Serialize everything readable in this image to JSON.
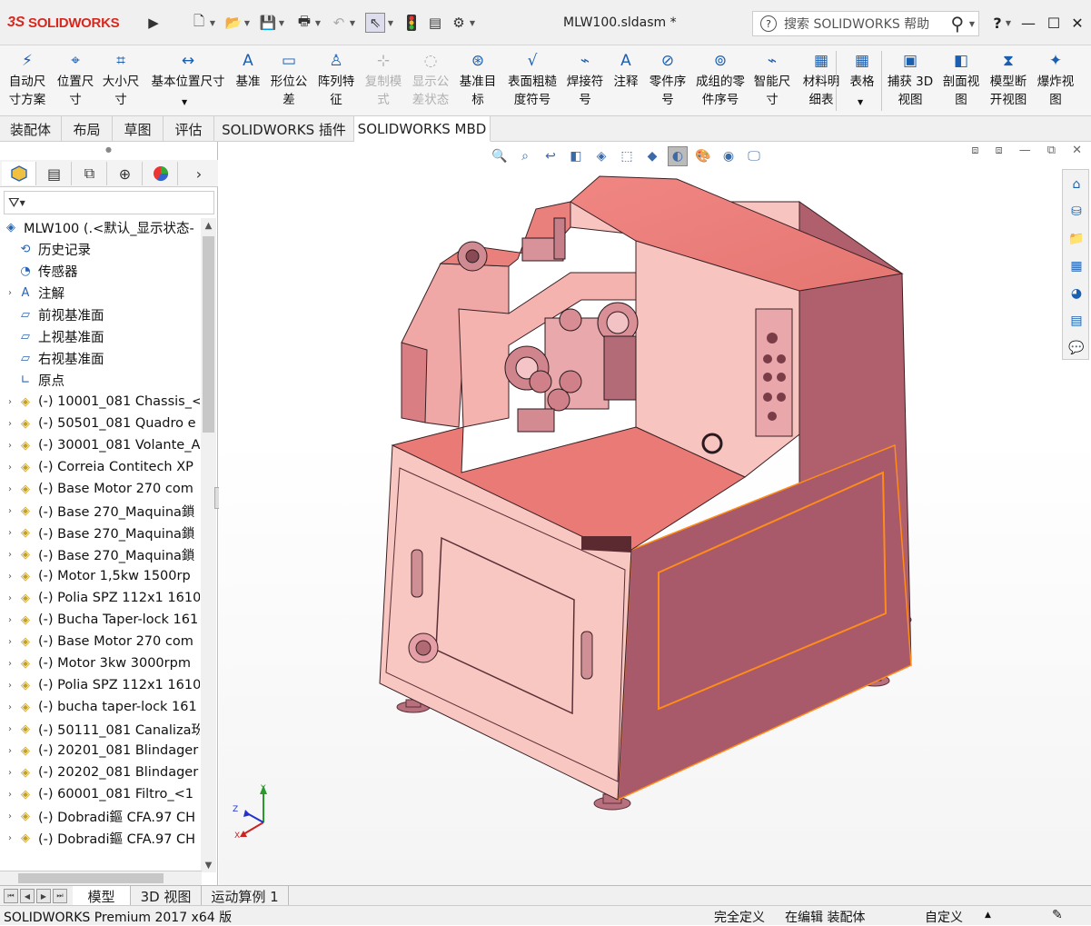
{
  "app": {
    "logo_ds": "3S",
    "logo_text": "SOLIDWORKS",
    "doc_title": "MLW100.sldasm *"
  },
  "search": {
    "placeholder": "搜索 SOLIDWORKS 帮助"
  },
  "quick_icons": [
    "new-icon",
    "open-icon",
    "save-icon",
    "print-icon",
    "undo-icon",
    "select-icon",
    "traffic-light-icon",
    "file-props-icon",
    "options-icon"
  ],
  "window": {
    "help": "?",
    "minimize": "—",
    "maximize": "☐",
    "close": "✕"
  },
  "ribbon": [
    {
      "id": "auto-dim",
      "lines": [
        "自动尺",
        "寸方案"
      ],
      "icon": "auto-dimension-icon",
      "enabled": true
    },
    {
      "id": "location-dim",
      "lines": [
        "位置尺",
        "寸"
      ],
      "icon": "location-dimension-icon",
      "enabled": true
    },
    {
      "id": "size-dim",
      "lines": [
        "大小尺",
        "寸"
      ],
      "icon": "size-dimension-icon",
      "enabled": true
    },
    {
      "id": "basic-location-dim",
      "lines": [
        "基本位置尺寸",
        ""
      ],
      "icon": "basic-location-icon",
      "enabled": true
    },
    {
      "id": "datum",
      "lines": [
        "基准",
        ""
      ],
      "icon": "datum-icon",
      "enabled": true
    },
    {
      "id": "geo-tol",
      "lines": [
        "形位公",
        "差"
      ],
      "icon": "geometric-tolerance-icon",
      "enabled": true
    },
    {
      "id": "pattern-feature",
      "lines": [
        "阵列特",
        "征"
      ],
      "icon": "pattern-feature-icon",
      "enabled": true
    },
    {
      "id": "copy-scheme",
      "lines": [
        "复制模",
        "式"
      ],
      "icon": "copy-scheme-icon",
      "enabled": false
    },
    {
      "id": "show-tol-status",
      "lines": [
        "显示公",
        "差状态"
      ],
      "icon": "tolerance-status-icon",
      "enabled": false
    },
    {
      "id": "datum-target",
      "lines": [
        "基准目",
        "标"
      ],
      "icon": "datum-target-icon",
      "enabled": true
    },
    {
      "id": "surface-finish",
      "lines": [
        "表面粗糙",
        "度符号"
      ],
      "icon": "surface-finish-icon",
      "enabled": true
    },
    {
      "id": "weld-symbol",
      "lines": [
        "焊接符",
        "号"
      ],
      "icon": "weld-symbol-icon",
      "enabled": true
    },
    {
      "id": "note",
      "lines": [
        "注释",
        ""
      ],
      "icon": "note-icon",
      "enabled": true
    },
    {
      "id": "balloon",
      "lines": [
        "零件序",
        "号"
      ],
      "icon": "balloon-icon",
      "enabled": true
    },
    {
      "id": "stacked-balloon",
      "lines": [
        "成组的零",
        "件序号"
      ],
      "icon": "stacked-balloon-icon",
      "enabled": true
    },
    {
      "id": "smart-dim",
      "lines": [
        "智能尺",
        "寸"
      ],
      "icon": "smart-dimension-icon",
      "enabled": true
    },
    {
      "id": "bom",
      "lines": [
        "材料明",
        "细表"
      ],
      "icon": "bom-icon",
      "enabled": true
    },
    {
      "id": "table",
      "lines": [
        "表格",
        ""
      ],
      "icon": "table-icon",
      "enabled": true
    },
    {
      "id": "capture-3d",
      "lines": [
        "捕获 3D",
        "视图"
      ],
      "icon": "capture-3d-view-icon",
      "enabled": true
    },
    {
      "id": "section-view",
      "lines": [
        "剖面视",
        "图"
      ],
      "icon": "section-view-icon",
      "enabled": true
    },
    {
      "id": "broken-view",
      "lines": [
        "模型断",
        "开视图"
      ],
      "icon": "broken-view-icon",
      "enabled": true
    },
    {
      "id": "exploded-view",
      "lines": [
        "爆炸视",
        "图"
      ],
      "icon": "exploded-view-icon",
      "enabled": true
    }
  ],
  "tabs": [
    "装配体",
    "布局",
    "草图",
    "评估",
    "SOLIDWORKS 插件",
    "SOLIDWORKS MBD"
  ],
  "active_tab": "SOLIDWORKS MBD",
  "tree": {
    "root": "MLW100  (.<默认_显示状态-",
    "items": [
      {
        "label": "历史记录",
        "icon": "history-icon",
        "expand": false
      },
      {
        "label": "传感器",
        "icon": "sensor-icon",
        "expand": false
      },
      {
        "label": "注解",
        "icon": "annotation-icon",
        "expand": true
      },
      {
        "label": "前视基准面",
        "icon": "plane-icon",
        "expand": false
      },
      {
        "label": "上视基准面",
        "icon": "plane-icon",
        "expand": false
      },
      {
        "label": "右视基准面",
        "icon": "plane-icon",
        "expand": false
      },
      {
        "label": "原点",
        "icon": "origin-icon",
        "expand": false
      },
      {
        "label": "(-) 10001_081 Chassis_<",
        "icon": "assembly-icon",
        "expand": true
      },
      {
        "label": "(-) 50501_081 Quadro e",
        "icon": "assembly-icon",
        "expand": true
      },
      {
        "label": "(-) 30001_081 Volante_A",
        "icon": "assembly-icon",
        "expand": true
      },
      {
        "label": "(-) Correia Contitech XP",
        "icon": "assembly-icon",
        "expand": true
      },
      {
        "label": "(-) Base Motor 270 com",
        "icon": "assembly-icon",
        "expand": true
      },
      {
        "label": "(-) Base  270_Maquina鎖",
        "icon": "assembly-icon",
        "expand": true
      },
      {
        "label": "(-) Base  270_Maquina鎖",
        "icon": "assembly-icon",
        "expand": true
      },
      {
        "label": "(-) Base  270_Maquina鎖",
        "icon": "assembly-icon",
        "expand": true
      },
      {
        "label": "(-) Motor 1,5kw 1500rp",
        "icon": "assembly-icon",
        "expand": true
      },
      {
        "label": "(-) Polia SPZ 112x1 1610",
        "icon": "assembly-icon",
        "expand": true
      },
      {
        "label": "(-) Bucha Taper-lock 161",
        "icon": "assembly-icon",
        "expand": true
      },
      {
        "label": "(-) Base Motor 270 com",
        "icon": "assembly-icon",
        "expand": true
      },
      {
        "label": "(-) Motor 3kw 3000rpm",
        "icon": "assembly-icon",
        "expand": true
      },
      {
        "label": "(-) Polia SPZ 112x1 1610",
        "icon": "assembly-icon",
        "expand": true
      },
      {
        "label": "(-) bucha taper-lock 161",
        "icon": "assembly-icon",
        "expand": true
      },
      {
        "label": "(-) 50111_081 Canaliza玢",
        "icon": "assembly-icon",
        "expand": true
      },
      {
        "label": "(-) 20201_081 Blindager",
        "icon": "assembly-icon",
        "expand": true
      },
      {
        "label": "(-) 20202_081 Blindager",
        "icon": "assembly-icon",
        "expand": true
      },
      {
        "label": "(-) 60001_081 Filtro_<1",
        "icon": "assembly-icon",
        "expand": true
      },
      {
        "label": "(-) Dobradi鏂 CFA.97 CH",
        "icon": "assembly-icon",
        "expand": true
      },
      {
        "label": "(-) Dobradi鏂 CFA.97 CH",
        "icon": "assembly-icon",
        "expand": true
      }
    ]
  },
  "bottom_tabs": [
    "模型",
    "3D 视图",
    "运动算例 1"
  ],
  "active_bottom_tab": "模型",
  "status": {
    "product": "SOLIDWORKS Premium 2017 x64 版",
    "defined": "完全定义",
    "editing": "在编辑 装配体",
    "custom": "自定义"
  },
  "triad": {
    "x": "X",
    "y": "Y",
    "z": "Z"
  },
  "colors": {
    "model_face": "#e9807c",
    "model_dark": "#b85c67",
    "model_light": "#f4b3ae",
    "edge_select": "#ff8c1a",
    "logo": "#d7281f"
  }
}
